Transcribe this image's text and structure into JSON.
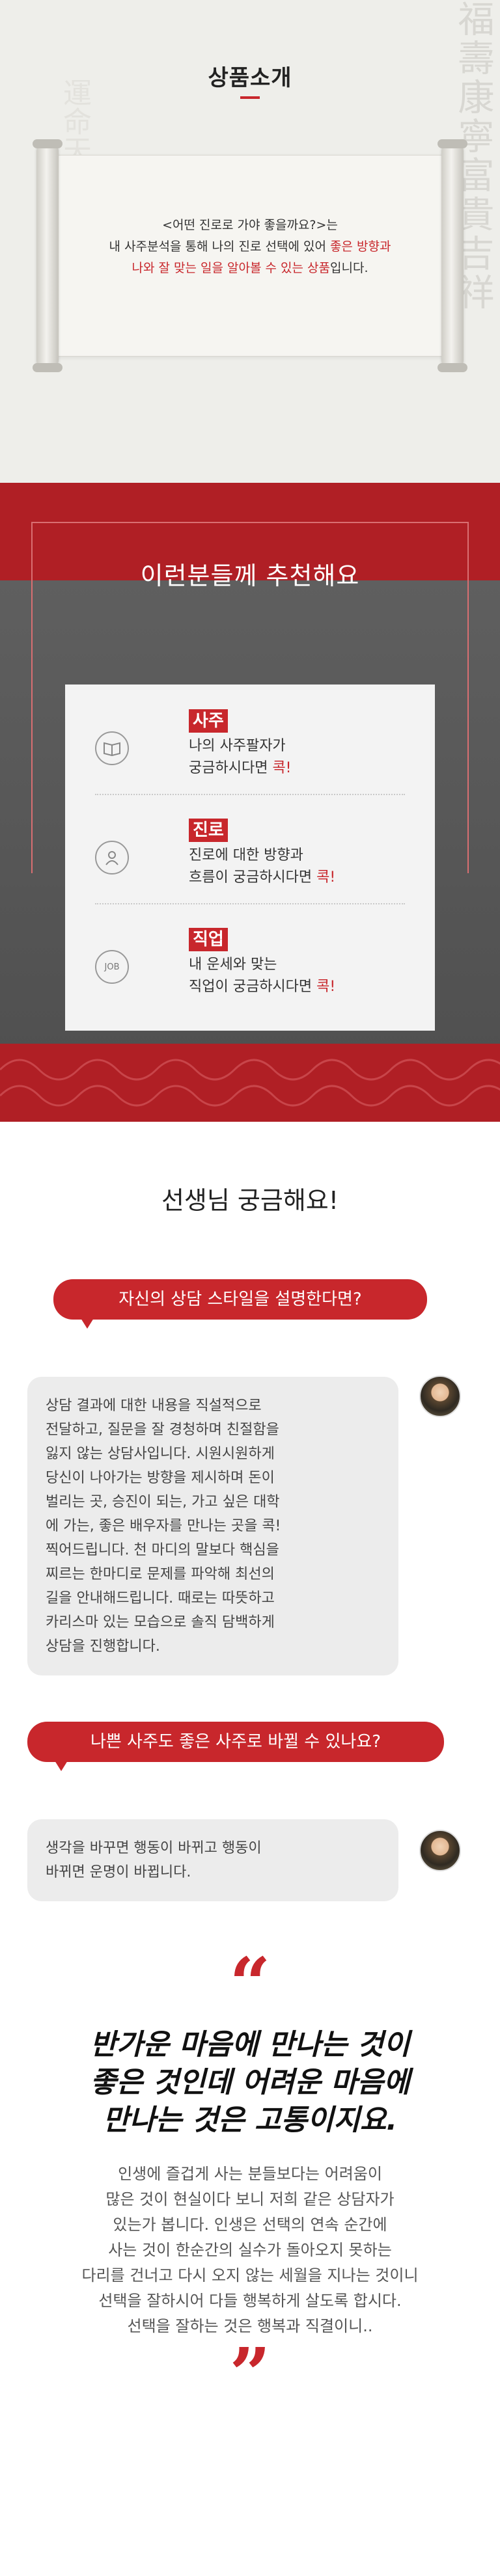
{
  "intro": {
    "title": "상품소개",
    "line1": "<어떤 진로로 가야 좋을까요?>는",
    "line2_a": "내 사주분석을 통해 나의 진로 선택에 있어 ",
    "line2_b": "좋은 방향과",
    "line3_a": "나와 잘 맞는 일을 알아볼 수 있는 상품",
    "line3_b": "입니다."
  },
  "recommend": {
    "title": "이런분들께 추천해요",
    "items": [
      {
        "tag": "사주",
        "line1": "나의 사주팔자가",
        "line2": "궁금하시다면 ",
        "highlight": "콕!",
        "icon": "book-icon"
      },
      {
        "tag": "진로",
        "line1": "진로에 대한 방향과",
        "line2": "흐름이 궁금하시다면 ",
        "highlight": "콕!",
        "icon": "person-icon"
      },
      {
        "tag": "직업",
        "line1": "내 운세와 맞는",
        "line2": "직업이 궁금하시다면 ",
        "highlight": "콕!",
        "icon": "job-icon",
        "icon_text": "JOB"
      }
    ]
  },
  "qa": {
    "title": "선생님 궁금해요!",
    "q1": "자신의 상담 스타일을 설명한다면?",
    "a1": [
      "상담 결과에 대한 내용을 직설적으로",
      "전달하고, 질문을 잘 경청하며 친절함을",
      "잃지 않는 상담사입니다. 시원시원하게",
      "당신이 나아가는 방향을 제시하며 돈이",
      "벌리는 곳, 승진이 되는, 가고 싶은 대학",
      "에 가는, 좋은 배우자를 만나는 곳을 콕!",
      "찍어드립니다. 천 마디의 말보다 핵심을",
      "찌르는 한마디로 문제를 파악해 최선의",
      "길을 안내해드립니다. 때로는 따뜻하고",
      "카리스마 있는 모습으로 솔직 담백하게",
      "상담을 진행합니다."
    ],
    "q2": "나쁜 사주도 좋은 사주로 바뀔 수 있나요?",
    "a2": [
      "생각을 바꾸면 행동이 바뀌고 행동이",
      "바뀌면 운명이 바뀝니다."
    ]
  },
  "quote": {
    "open": "“",
    "close": "”",
    "heading": [
      "반가운 마음에 만나는 것이",
      "좋은 것인데 어려운 마음에",
      "만나는 것은 고통이지요."
    ],
    "body": [
      "인생에 즐겁게 사는 분들보다는 어려움이",
      "많은 것이 현실이다 보니 저희 같은 상담자가",
      "있는가 봅니다. 인생은 선택의 연속 순간에",
      "사는 것이 한순간의 실수가 돌아오지 못하는",
      "다리를 건너고 다시 오지 않는 세월을 지나는 것이니",
      "선택을 잘하시어 다들 행복하게 살도록 합시다.",
      "선택을 잘하는 것은 행복과 직결이니.."
    ]
  },
  "colors": {
    "accent": "#c8272c",
    "dark": "#4e4e4e",
    "paper": "#f6f5f1"
  }
}
